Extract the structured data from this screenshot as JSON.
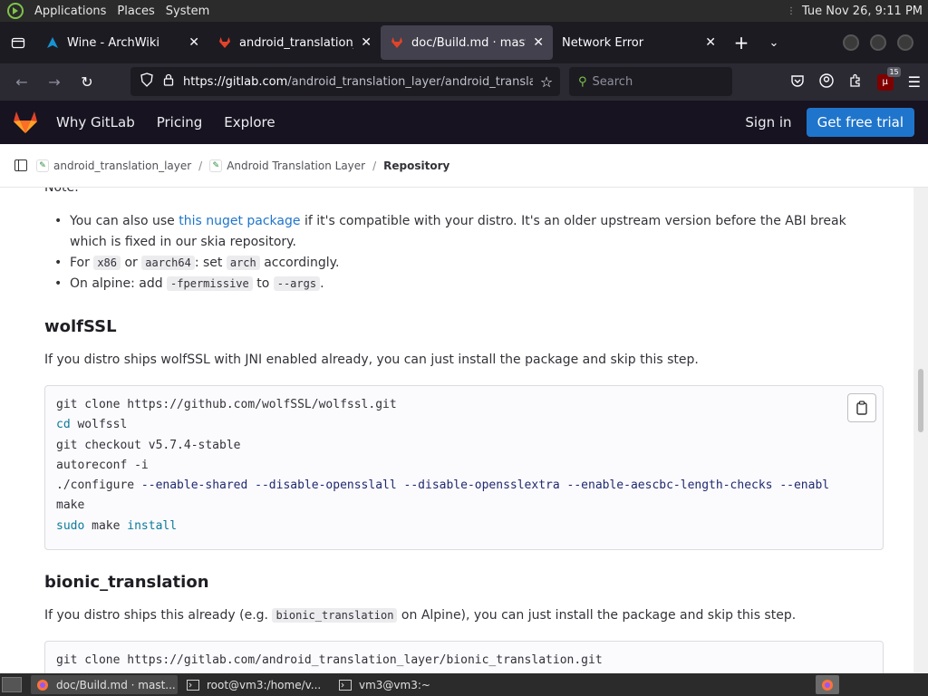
{
  "system_panel": {
    "applications": "Applications",
    "places": "Places",
    "system": "System",
    "clock": "Tue Nov 26,  9:11 PM"
  },
  "tabs": [
    {
      "title": "Wine - ArchWiki",
      "favicon": "archlinux-icon"
    },
    {
      "title": "android_translation_la",
      "favicon": "gitlab-icon"
    },
    {
      "title": "doc/Build.md · master",
      "favicon": "gitlab-icon",
      "active": true
    },
    {
      "title": "Network Error",
      "favicon": "none"
    }
  ],
  "navbar": {
    "url_host": "https://gitlab.com",
    "url_path": "/android_translation_layer/android_translati",
    "search_placeholder": "Search",
    "ublock_count": "15"
  },
  "gitlab_header": {
    "why": "Why GitLab",
    "pricing": "Pricing",
    "explore": "Explore",
    "signin": "Sign in",
    "trial": "Get free trial"
  },
  "breadcrumb": {
    "group": "android_translation_layer",
    "project": "Android Translation Layer",
    "current": "Repository"
  },
  "content": {
    "note": "Note:",
    "bullets": {
      "b1_pre": "You can also use ",
      "b1_link": "this nuget package",
      "b1_post": " if it's compatible with your distro. It's an older upstream version before the ABI break which is fixed in our skia repository.",
      "b2_pre": "For ",
      "b2_code1": "x86",
      "b2_mid1": " or ",
      "b2_code2": "aarch64",
      "b2_mid2": ": set ",
      "b2_code3": "arch",
      "b2_post": " accordingly.",
      "b3_pre": "On alpine: add ",
      "b3_code1": "-fpermissive",
      "b3_mid": " to ",
      "b3_code2": "--args",
      "b3_post": "."
    },
    "wolfssl_heading": "wolfSSL",
    "wolfssl_text": "If you distro ships wolfSSL with JNI enabled already, you can just install the package and skip this step.",
    "wolfssl_code": {
      "l1": "git clone https://github.com/wolfSSL/wolfssl.git",
      "l2_kw": "cd",
      "l2_rest": " wolfssl",
      "l3": "git checkout v5.7.4-stable",
      "l4": "autoreconf -i",
      "l5_pre": "./configure ",
      "l5_opts": "--enable-shared --disable-opensslall --disable-opensslextra --enable-aescbc-length-checks --enabl",
      "l6": "make",
      "l7_kw": "sudo",
      "l7_mid": " make ",
      "l7_kw2": "install"
    },
    "bionic_heading": "bionic_translation",
    "bionic_pre": "If you distro ships this already (e.g. ",
    "bionic_code": "bionic_translation",
    "bionic_post": " on Alpine), you can just install the package and skip this step.",
    "bionic_code_line": "git clone https://gitlab.com/android_translation_layer/bionic_translation.git"
  },
  "taskbar": {
    "task1": "doc/Build.md · mast...",
    "task2": "root@vm3:/home/v...",
    "task3": "vm3@vm3:~"
  }
}
